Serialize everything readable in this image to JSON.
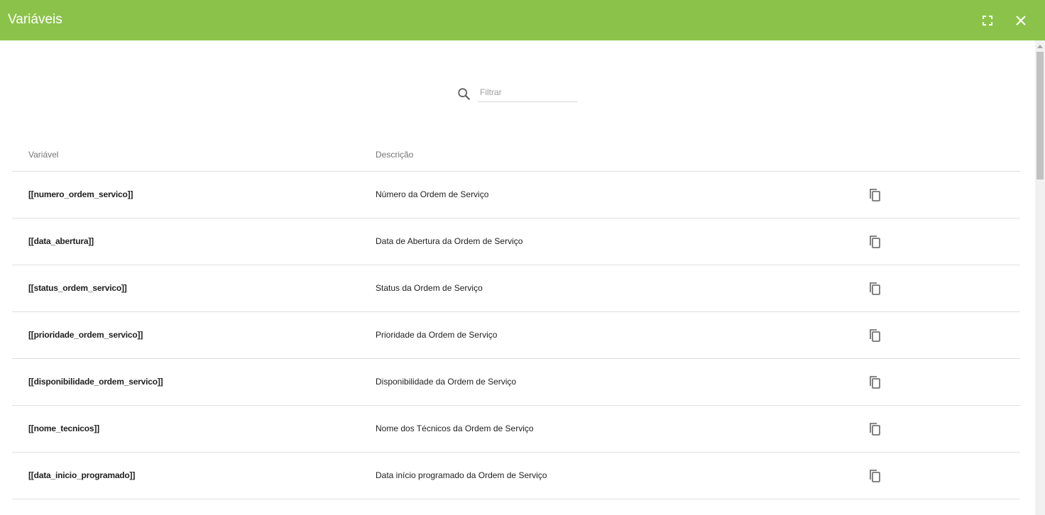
{
  "dialog": {
    "title": "Variáveis",
    "icons": {
      "fullscreen": "fullscreen-icon",
      "close": "close-icon",
      "search": "search-icon",
      "copy": "copy-icon"
    },
    "colors": {
      "header": "#8bc34a",
      "header_text": "#ffffff"
    }
  },
  "search": {
    "placeholder": "Filtrar",
    "value": ""
  },
  "table": {
    "columns": [
      "Variável",
      "Descrição"
    ],
    "rows": [
      {
        "variable": "[[numero_ordem_servico]]",
        "description": "Número da Ordem de Serviço"
      },
      {
        "variable": "[[data_abertura]]",
        "description": "Data de Abertura da Ordem de Serviço"
      },
      {
        "variable": "[[status_ordem_servico]]",
        "description": "Status da Ordem de Serviço"
      },
      {
        "variable": "[[prioridade_ordem_servico]]",
        "description": "Prioridade da Ordem de Serviço"
      },
      {
        "variable": "[[disponibilidade_ordem_servico]]",
        "description": "Disponibilidade da Ordem de Serviço"
      },
      {
        "variable": "[[nome_tecnicos]]",
        "description": "Nome dos Técnicos da Ordem de Serviço"
      },
      {
        "variable": "[[data_inicio_programado]]",
        "description": "Data início programado da Ordem de Serviço"
      }
    ]
  }
}
